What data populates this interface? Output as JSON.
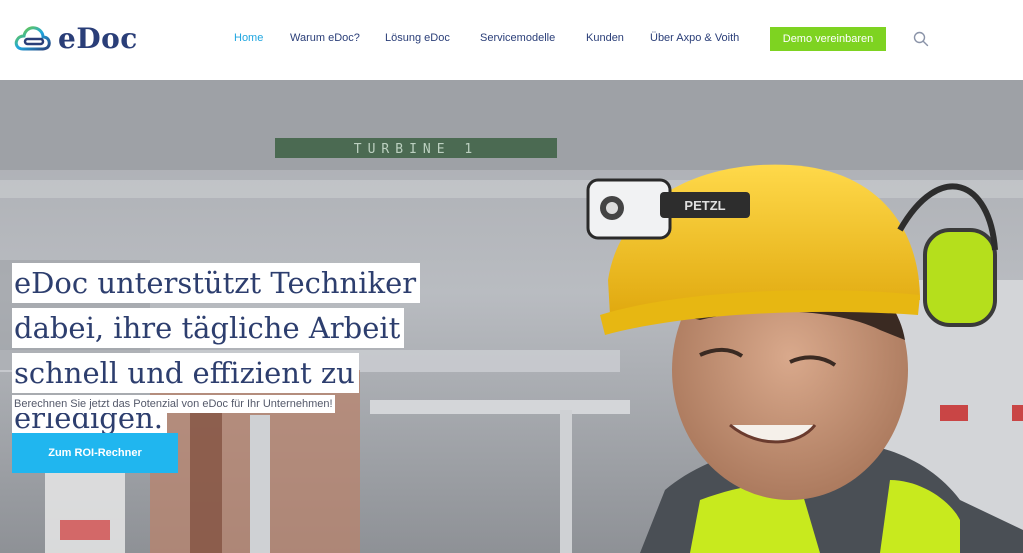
{
  "brand": {
    "name": "eDoc"
  },
  "nav": {
    "items": [
      {
        "label": "Home",
        "active": true
      },
      {
        "label": "Warum eDoc?"
      },
      {
        "label": "Lösung eDoc"
      },
      {
        "label": "Servicemodelle"
      },
      {
        "label": "Kunden"
      },
      {
        "label": "Über Axpo & Voith"
      }
    ],
    "cta_label": "Demo vereinbaren",
    "search_icon": "search-icon"
  },
  "hero": {
    "headline_lines": [
      "eDoc unterstützt Techniker",
      "dabei, ihre tägliche Arbeit",
      "schnell und effizient zu",
      "erledigen."
    ],
    "subline": "Berechnen Sie jetzt das Potenzial von eDoc für Ihr Unternehmen!",
    "button_label": "Zum ROI-Rechner",
    "sign_text": "TURBINE 1"
  },
  "colors": {
    "brand_blue": "#2a3e78",
    "nav_active": "#1fa6e0",
    "cta_green": "#7ed321",
    "button_blue": "#20b6ef",
    "helmet_yellow": "#f2c417",
    "vest_green": "#c8ea1e"
  }
}
